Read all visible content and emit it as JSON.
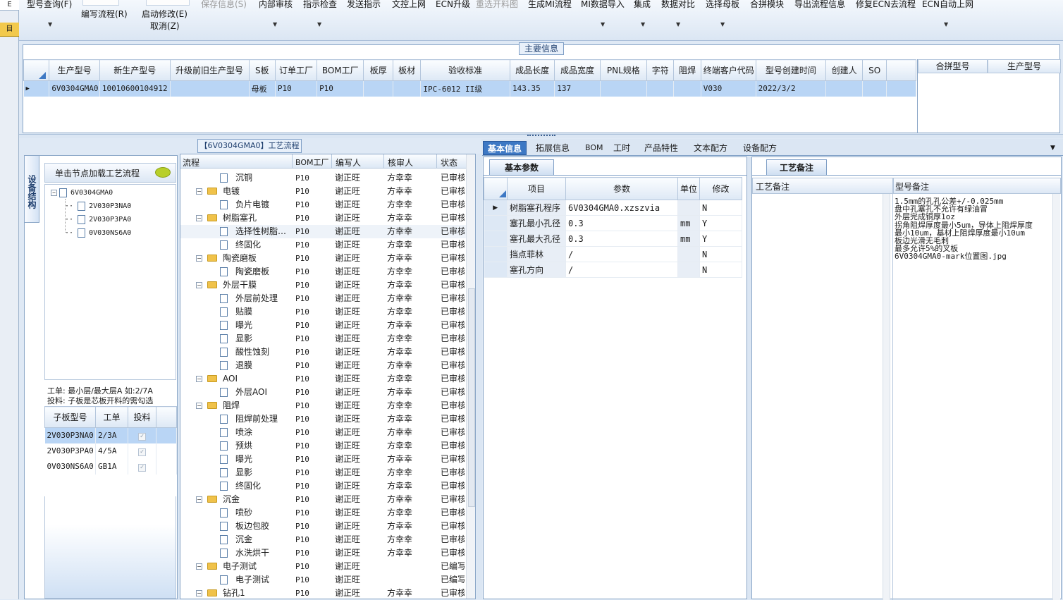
{
  "leftstrip": {
    "top_char": "E",
    "mark_char": "目"
  },
  "toolbar": {
    "items": [
      {
        "label": "型号查询(F)",
        "disabled": false
      },
      {
        "label": "编写流程(R)",
        "disabled": false
      },
      {
        "label": "启动修改(E)",
        "disabled": false
      },
      {
        "label": "取消(Z)",
        "disabled": false
      },
      {
        "label": "保存信息(S)",
        "disabled": true
      },
      {
        "label": "内部审核",
        "disabled": false
      },
      {
        "label": "指示检查",
        "disabled": false
      },
      {
        "label": "发送指示",
        "disabled": false
      },
      {
        "label": "文控上网",
        "disabled": false
      },
      {
        "label": "ECN升级",
        "disabled": false
      },
      {
        "label": "重选开料图",
        "disabled": true
      },
      {
        "label": "生成MI流程",
        "disabled": false
      },
      {
        "label": "MI数据导入",
        "disabled": false
      },
      {
        "label": "集成",
        "disabled": false
      },
      {
        "label": "数据对比",
        "disabled": false
      },
      {
        "label": "选择母板",
        "disabled": false
      },
      {
        "label": "合拼模块",
        "disabled": false
      },
      {
        "label": "导出流程信息",
        "disabled": false
      },
      {
        "label": "修复ECN去流程",
        "disabled": false
      },
      {
        "label": "ECN自动上网",
        "disabled": false
      }
    ],
    "dropdown_glyph": "▼"
  },
  "main_info": {
    "title": "主要信息",
    "columns": [
      "生产型号",
      "新生产型号",
      "升级前旧生产型号",
      "S板",
      "订单工厂",
      "BOM工厂",
      "板厚",
      "板材",
      "验收标准",
      "成品长度",
      "成品宽度",
      "PNL规格",
      "字符",
      "阻焊",
      "终端客户代码",
      "型号创建时间",
      "创建人",
      "SO"
    ],
    "row": {
      "prod": "6V0304GMA0",
      "new": "10010600104912",
      "old": "",
      "s": "母板",
      "order": "P10",
      "bom": "P10",
      "thick": "",
      "mat": "",
      "std": "IPC-6012 II级",
      "len": "143.35",
      "wid": "137",
      "pnl": "",
      "char": "",
      "mask": "",
      "cust": "V030",
      "time": "2022/3/2",
      "creator": "",
      "so": ""
    },
    "row_pointer": "▶",
    "side_columns": [
      "合拼型号",
      "生产型号"
    ]
  },
  "process": {
    "title": "【6V0304GMA0】工艺流程",
    "vtab": "设备结构",
    "load_hint": "单击节点加载工艺流程",
    "tree": {
      "root": "6V0304GMA0",
      "children": [
        "2V030P3NA0",
        "2V030P3PA0",
        "0V030NS6A0"
      ]
    },
    "note1": "工单: 最小层/最大层A 如:2/7A",
    "note2": "投料: 子板是芯板开料的需勾选",
    "sub_columns": [
      "子板型号",
      "工单",
      "投料"
    ],
    "sub_rows": [
      {
        "model": "2V030P3NA0",
        "order": "2/3A",
        "feed": "✓"
      },
      {
        "model": "2V030P3PA0",
        "order": "4/5A",
        "feed": "✓"
      },
      {
        "model": "0V030NS6A0",
        "order": "GB1A",
        "feed": "✓"
      }
    ],
    "flow_columns": [
      "流程",
      "BOM工厂",
      "编写人",
      "核审人",
      "状态"
    ],
    "flow_rows": [
      {
        "name": "沉铜",
        "folder": false,
        "bom": "P10",
        "writer": "谢正旺",
        "reviewer": "方幸幸",
        "status": "已审核"
      },
      {
        "name": "电镀",
        "folder": true,
        "bom": "P10",
        "writer": "谢正旺",
        "reviewer": "方幸幸",
        "status": "已审核"
      },
      {
        "name": "负片电镀",
        "folder": false,
        "bom": "P10",
        "writer": "谢正旺",
        "reviewer": "方幸幸",
        "status": "已审核"
      },
      {
        "name": "树脂塞孔",
        "folder": true,
        "bom": "P10",
        "writer": "谢正旺",
        "reviewer": "方幸幸",
        "status": "已审核"
      },
      {
        "name": "选择性树脂…",
        "folder": false,
        "bom": "P10",
        "writer": "谢正旺",
        "reviewer": "方幸幸",
        "status": "已审核"
      },
      {
        "name": "终固化",
        "folder": false,
        "bom": "P10",
        "writer": "谢正旺",
        "reviewer": "方幸幸",
        "status": "已审核"
      },
      {
        "name": "陶瓷磨板",
        "folder": true,
        "bom": "P10",
        "writer": "谢正旺",
        "reviewer": "方幸幸",
        "status": "已审核"
      },
      {
        "name": "陶瓷磨板",
        "folder": false,
        "bom": "P10",
        "writer": "谢正旺",
        "reviewer": "方幸幸",
        "status": "已审核"
      },
      {
        "name": "外层干膜",
        "folder": true,
        "bom": "P10",
        "writer": "谢正旺",
        "reviewer": "方幸幸",
        "status": "已审核"
      },
      {
        "name": "外层前处理",
        "folder": false,
        "bom": "P10",
        "writer": "谢正旺",
        "reviewer": "方幸幸",
        "status": "已审核"
      },
      {
        "name": "贴膜",
        "folder": false,
        "bom": "P10",
        "writer": "谢正旺",
        "reviewer": "方幸幸",
        "status": "已审核"
      },
      {
        "name": "曝光",
        "folder": false,
        "bom": "P10",
        "writer": "谢正旺",
        "reviewer": "方幸幸",
        "status": "已审核"
      },
      {
        "name": "显影",
        "folder": false,
        "bom": "P10",
        "writer": "谢正旺",
        "reviewer": "方幸幸",
        "status": "已审核"
      },
      {
        "name": "酸性蚀刻",
        "folder": false,
        "bom": "P10",
        "writer": "谢正旺",
        "reviewer": "方幸幸",
        "status": "已审核"
      },
      {
        "name": "退膜",
        "folder": false,
        "bom": "P10",
        "writer": "谢正旺",
        "reviewer": "方幸幸",
        "status": "已审核"
      },
      {
        "name": "AOI",
        "folder": true,
        "bom": "P10",
        "writer": "谢正旺",
        "reviewer": "方幸幸",
        "status": "已审核"
      },
      {
        "name": "外层AOI",
        "folder": false,
        "bom": "P10",
        "writer": "谢正旺",
        "reviewer": "方幸幸",
        "status": "已审核"
      },
      {
        "name": "阻焊",
        "folder": true,
        "bom": "P10",
        "writer": "谢正旺",
        "reviewer": "方幸幸",
        "status": "已审核"
      },
      {
        "name": "阻焊前处理",
        "folder": false,
        "bom": "P10",
        "writer": "谢正旺",
        "reviewer": "方幸幸",
        "status": "已审核"
      },
      {
        "name": "喷涂",
        "folder": false,
        "bom": "P10",
        "writer": "谢正旺",
        "reviewer": "方幸幸",
        "status": "已审核"
      },
      {
        "name": "预烘",
        "folder": false,
        "bom": "P10",
        "writer": "谢正旺",
        "reviewer": "方幸幸",
        "status": "已审核"
      },
      {
        "name": "曝光",
        "folder": false,
        "bom": "P10",
        "writer": "谢正旺",
        "reviewer": "方幸幸",
        "status": "已审核"
      },
      {
        "name": "显影",
        "folder": false,
        "bom": "P10",
        "writer": "谢正旺",
        "reviewer": "方幸幸",
        "status": "已审核"
      },
      {
        "name": "终固化",
        "folder": false,
        "bom": "P10",
        "writer": "谢正旺",
        "reviewer": "方幸幸",
        "status": "已审核"
      },
      {
        "name": "沉金",
        "folder": true,
        "bom": "P10",
        "writer": "谢正旺",
        "reviewer": "方幸幸",
        "status": "已审核"
      },
      {
        "name": "喷砂",
        "folder": false,
        "bom": "P10",
        "writer": "谢正旺",
        "reviewer": "方幸幸",
        "status": "已审核"
      },
      {
        "name": "板边包胶",
        "folder": false,
        "bom": "P10",
        "writer": "谢正旺",
        "reviewer": "方幸幸",
        "status": "已审核"
      },
      {
        "name": "沉金",
        "folder": false,
        "bom": "P10",
        "writer": "谢正旺",
        "reviewer": "方幸幸",
        "status": "已审核"
      },
      {
        "name": "水洗烘干",
        "folder": false,
        "bom": "P10",
        "writer": "谢正旺",
        "reviewer": "方幸幸",
        "status": "已审核"
      },
      {
        "name": "电子测试",
        "folder": true,
        "bom": "P10",
        "writer": "谢正旺",
        "reviewer": "",
        "status": "已编写"
      },
      {
        "name": "电子测试",
        "folder": false,
        "bom": "P10",
        "writer": "谢正旺",
        "reviewer": "",
        "status": "已编写"
      },
      {
        "name": "钻孔1",
        "folder": true,
        "bom": "P10",
        "writer": "谢正旺",
        "reviewer": "方幸幸",
        "status": "已审核"
      }
    ]
  },
  "right": {
    "tabs": [
      "基本信息",
      "拓展信息",
      "BOM",
      "工时",
      "产品特性",
      "文本配方",
      "设备配方"
    ],
    "basic_title": "基本参数",
    "basic_columns": [
      "项目",
      "参数",
      "单位",
      "修改"
    ],
    "basic_rows": [
      {
        "item": "树脂塞孔程序",
        "param": "6V0304GMA0.xzszvia",
        "unit": "",
        "mod": "N"
      },
      {
        "item": "塞孔最小孔径",
        "param": "0.3",
        "unit": "mm",
        "mod": "Y"
      },
      {
        "item": "塞孔最大孔径",
        "param": "0.3",
        "unit": "mm",
        "mod": "Y"
      },
      {
        "item": "挡点菲林",
        "param": "/",
        "unit": "",
        "mod": "N"
      },
      {
        "item": "塞孔方向",
        "param": "/",
        "unit": "",
        "mod": "N"
      }
    ],
    "craft_title": "工艺备注",
    "craft_columns": [
      "工艺备注",
      "型号备注"
    ],
    "model_notes": [
      "1.5mm的孔孔公差+/-0.025mm",
      "盘中孔塞孔不允许有绿油冒",
      "外层完成铜厚1oz",
      "拐角阻焊厚度最小5um，导体上阻焊厚度",
      "最小10um，基材上阻焊厚度最小10um",
      "板边光滑无毛刺",
      "最多允许5%的叉板",
      "6V0304GMA0-mark位置图.jpg"
    ]
  }
}
